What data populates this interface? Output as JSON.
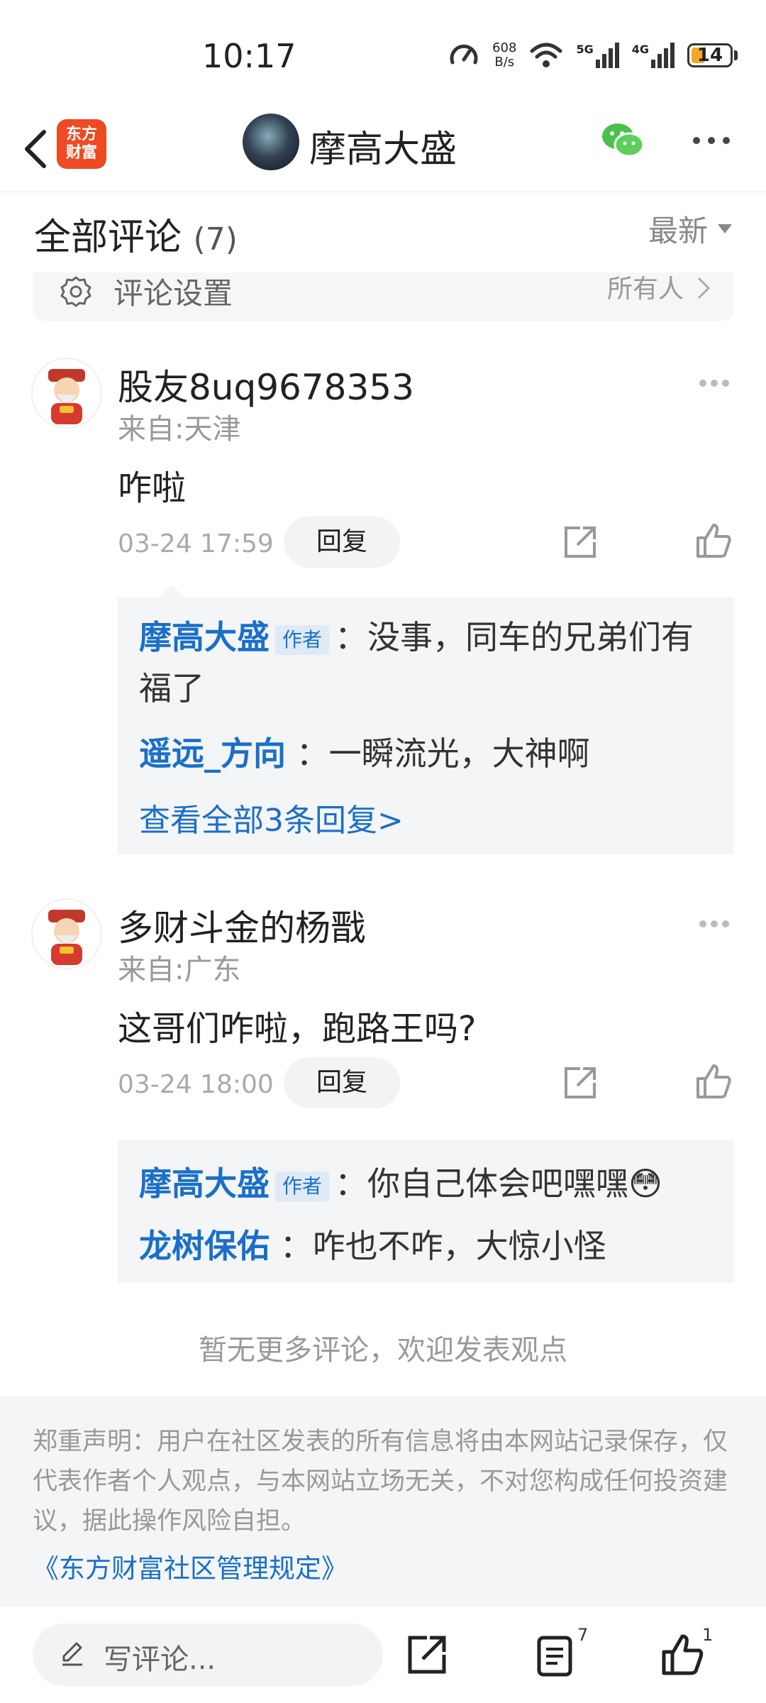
{
  "status": {
    "time": "10:17",
    "net_speed_value": "608",
    "net_speed_unit": "B/s",
    "battery": "14",
    "sig1": "5G",
    "sig2": "4G"
  },
  "nav": {
    "logo_line1": "东方",
    "logo_line2": "财富",
    "title": "摩高大盛"
  },
  "header": {
    "title": "全部评论",
    "count": "(7)",
    "sort_label": "最新"
  },
  "settings": {
    "label": "评论设置",
    "value": "所有人"
  },
  "comments": [
    {
      "user": "股友8uq9678353",
      "location": "来自:天津",
      "text": "咋啦",
      "time": "03-24 17:59",
      "reply_label": "回复",
      "replies": [
        {
          "user": "摩高大盛",
          "tag": "作者",
          "text": "：没事，同车的兄弟们有",
          "text2": "福了"
        },
        {
          "user": "遥远_方向",
          "text": " ：一瞬流光，大神啊"
        }
      ],
      "view_all": "查看全部3条回复>"
    },
    {
      "user": "多财斗金的杨戬",
      "location": "来自:广东",
      "text": "这哥们咋啦，跑路王吗?",
      "time": "03-24 18:00",
      "reply_label": "回复",
      "replies": [
        {
          "user": "摩高大盛",
          "tag": "作者",
          "text": "：你自己体会吧嘿嘿",
          "emoji": "😳"
        },
        {
          "user": "龙树保佑",
          "text": " ：咋也不咋，大惊小怪"
        }
      ]
    }
  ],
  "no_more": "暂无更多评论，欢迎发表观点",
  "disclaimer": {
    "text": "郑重声明：用户在社区发表的所有信息将由本网站记录保存，仅代表作者个人观点，与本网站立场无关，不对您构成任何投资建议，据此操作风险自担。",
    "link": "《东方财富社区管理规定》"
  },
  "bottom_bar": {
    "placeholder": "写评论...",
    "comments_badge": "7",
    "likes_badge": "1"
  }
}
